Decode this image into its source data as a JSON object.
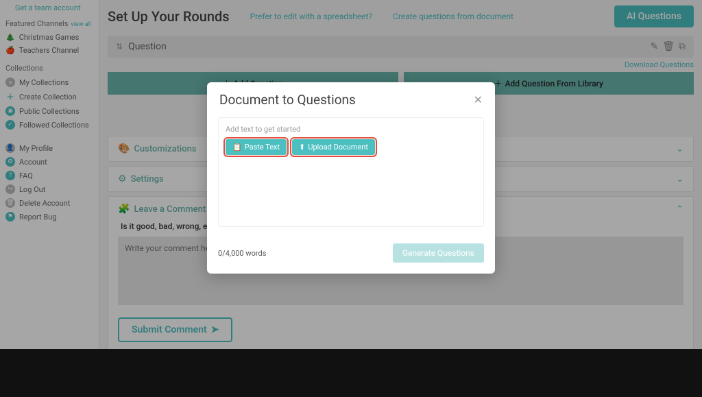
{
  "sidebar": {
    "team_link": "Get a team account",
    "featured_label": "Featured Channels",
    "view_all": "view all",
    "featured": [
      {
        "label": "Christmas Games"
      },
      {
        "label": "Teachers Channel"
      }
    ],
    "collections_label": "Collections",
    "collections": [
      {
        "label": "My Collections"
      },
      {
        "label": "Create Collection"
      },
      {
        "label": "Public Collections"
      },
      {
        "label": "Followed Collections"
      }
    ],
    "account": [
      {
        "label": "My Profile"
      },
      {
        "label": "Account"
      },
      {
        "label": "FAQ"
      },
      {
        "label": "Log Out"
      },
      {
        "label": "Delete Account"
      },
      {
        "label": "Report Bug"
      }
    ]
  },
  "header": {
    "title": "Set Up Your Rounds",
    "link1": "Prefer to edit with a spreadsheet?",
    "link2": "Create questions from document",
    "ai_btn": "AI Questions"
  },
  "question_bar": {
    "label": "Question"
  },
  "download_link": "Download Questions",
  "buttons": {
    "add_q": "Add Question",
    "add_lib": "Add Question From Library"
  },
  "accordions": {
    "custom": "Customizations",
    "settings": "Settings",
    "comment": "Leave a Comment"
  },
  "comment": {
    "prompt": "Is it good, bad, wrong, etc?",
    "placeholder": "Write your comment here!",
    "submit": "Submit Comment"
  },
  "modal": {
    "title": "Document to Questions",
    "hint": "Add text to get started",
    "paste": "Paste Text",
    "upload": "Upload Document",
    "wordcount": "0/4,000 words",
    "generate": "Generate Questions"
  }
}
